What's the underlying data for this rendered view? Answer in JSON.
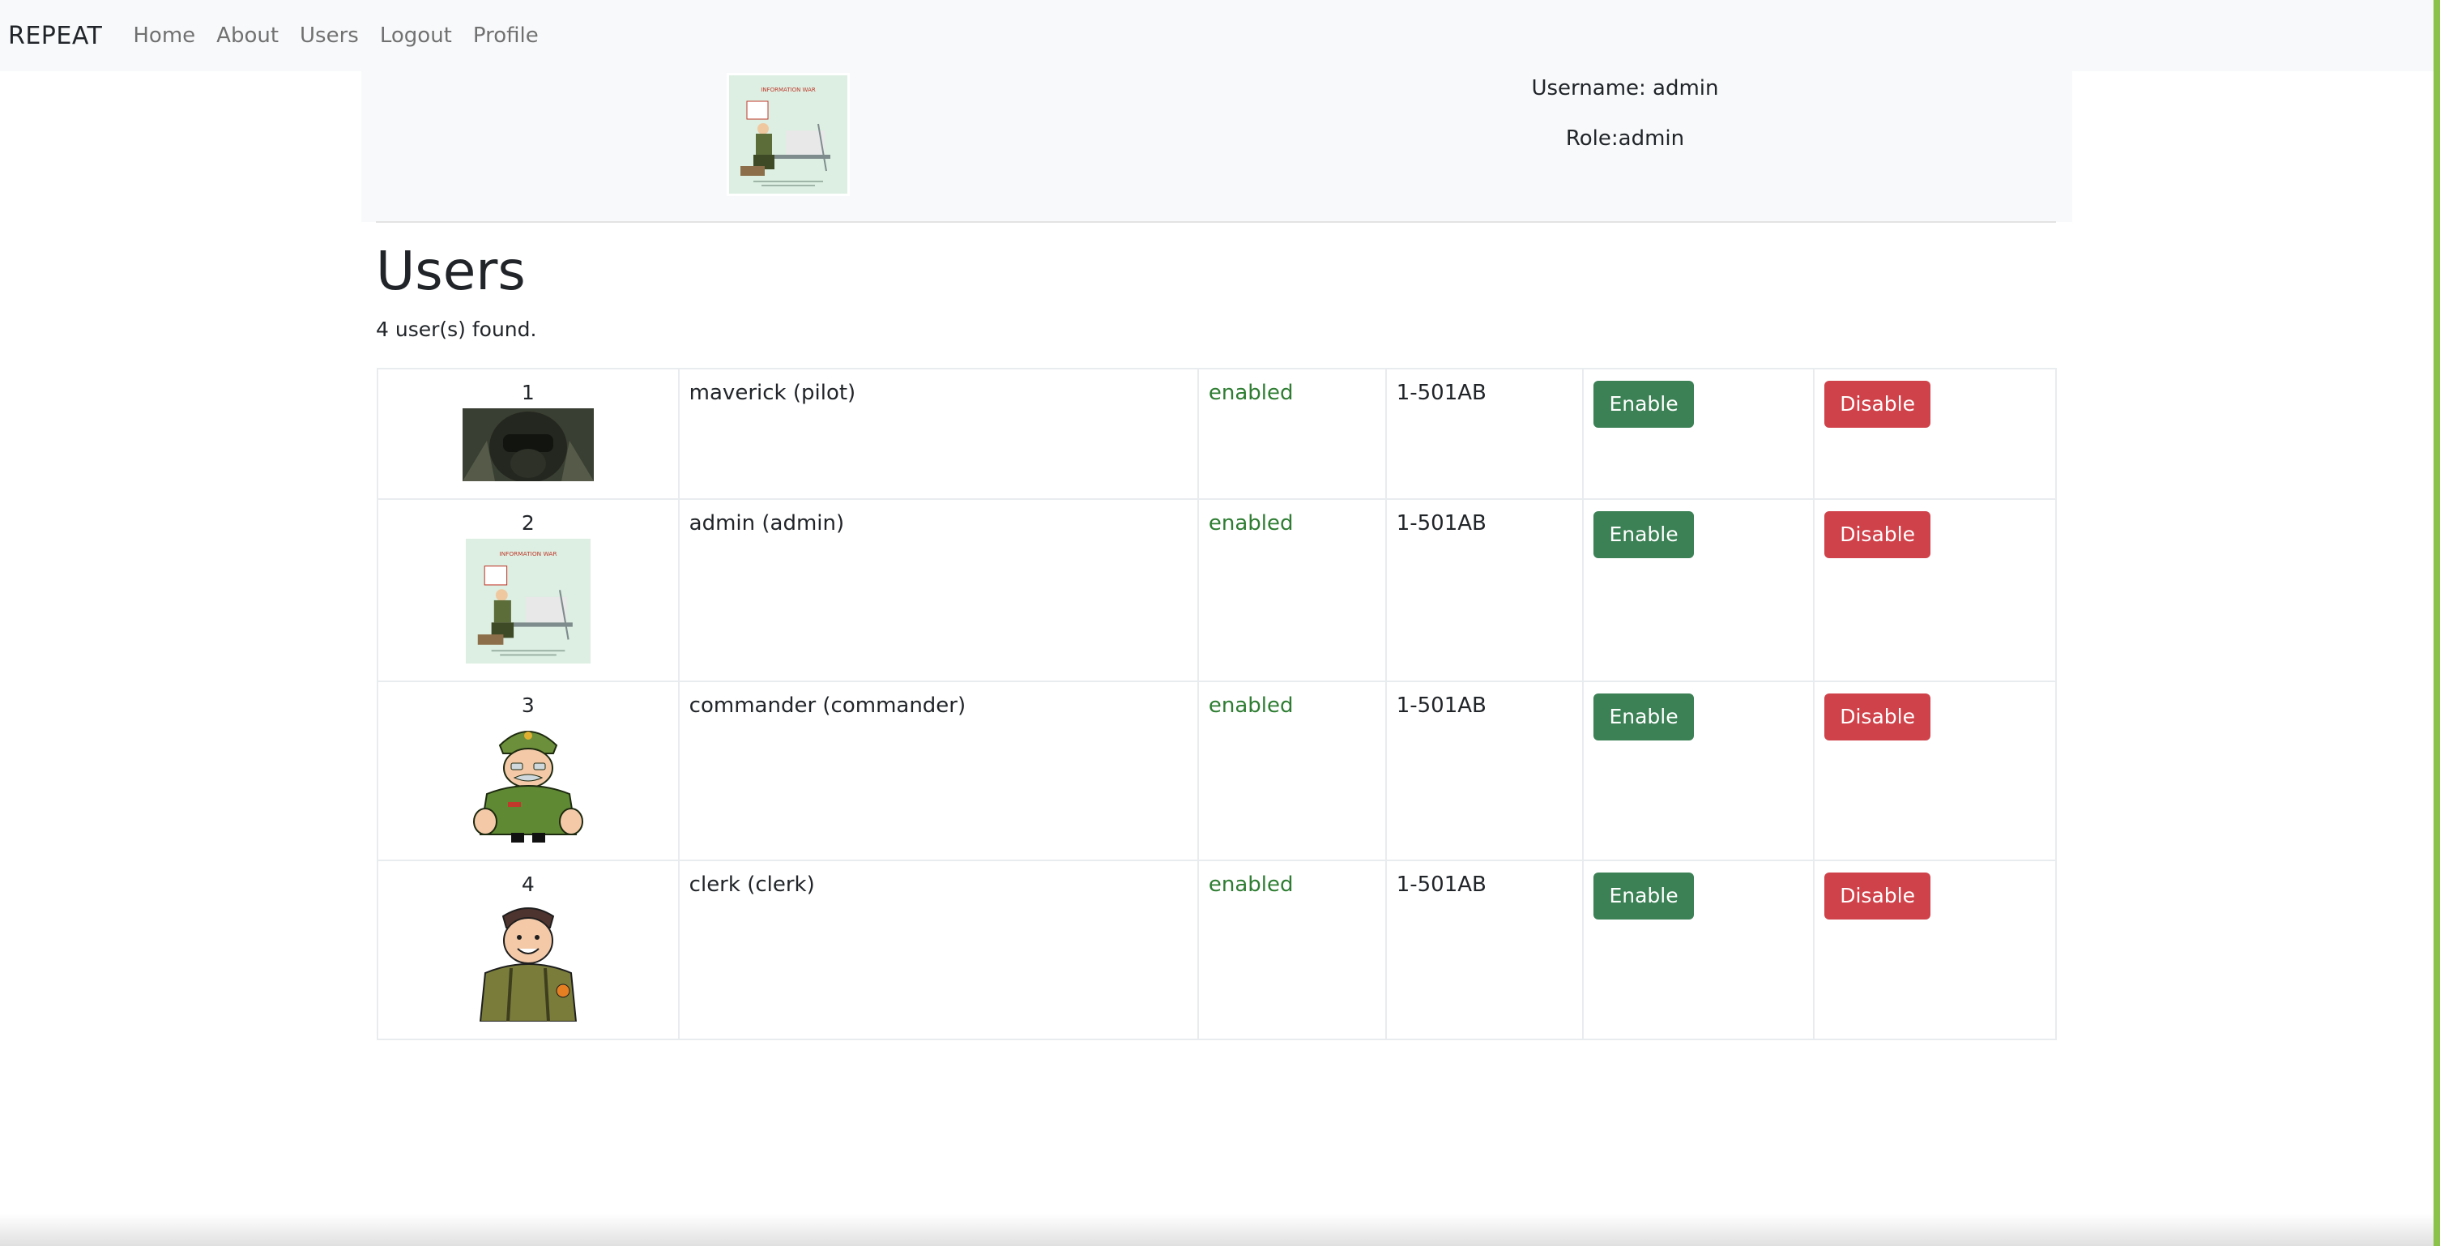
{
  "navbar": {
    "brand": "REPEAT",
    "links": [
      "Home",
      "About",
      "Users",
      "Logout",
      "Profile"
    ]
  },
  "profile": {
    "username_text": "Username: admin",
    "role_text": "Role:admin",
    "avatar_caption": "INFORMATION WAR"
  },
  "page": {
    "title": "Users",
    "found_text": "4 user(s) found."
  },
  "users": [
    {
      "num": "1",
      "name": "maverick (pilot)",
      "status": "enabled",
      "code": "1-501AB",
      "enable_label": "Enable",
      "disable_label": "Disable",
      "avatar": "pilot-helmet"
    },
    {
      "num": "2",
      "name": "admin (admin)",
      "status": "enabled",
      "code": "1-501AB",
      "enable_label": "Enable",
      "disable_label": "Disable",
      "avatar": "information-war-poster"
    },
    {
      "num": "3",
      "name": "commander (commander)",
      "status": "enabled",
      "code": "1-501AB",
      "enable_label": "Enable",
      "disable_label": "Disable",
      "avatar": "cartoon-commander"
    },
    {
      "num": "4",
      "name": "clerk (clerk)",
      "status": "enabled",
      "code": "1-501AB",
      "enable_label": "Enable",
      "disable_label": "Disable",
      "avatar": "cartoon-clerk"
    }
  ],
  "colors": {
    "enable_button": "#3b8155",
    "disable_button": "#d0424a",
    "status_enabled": "#2e7d32",
    "navbar_bg": "#f8f9fa"
  }
}
